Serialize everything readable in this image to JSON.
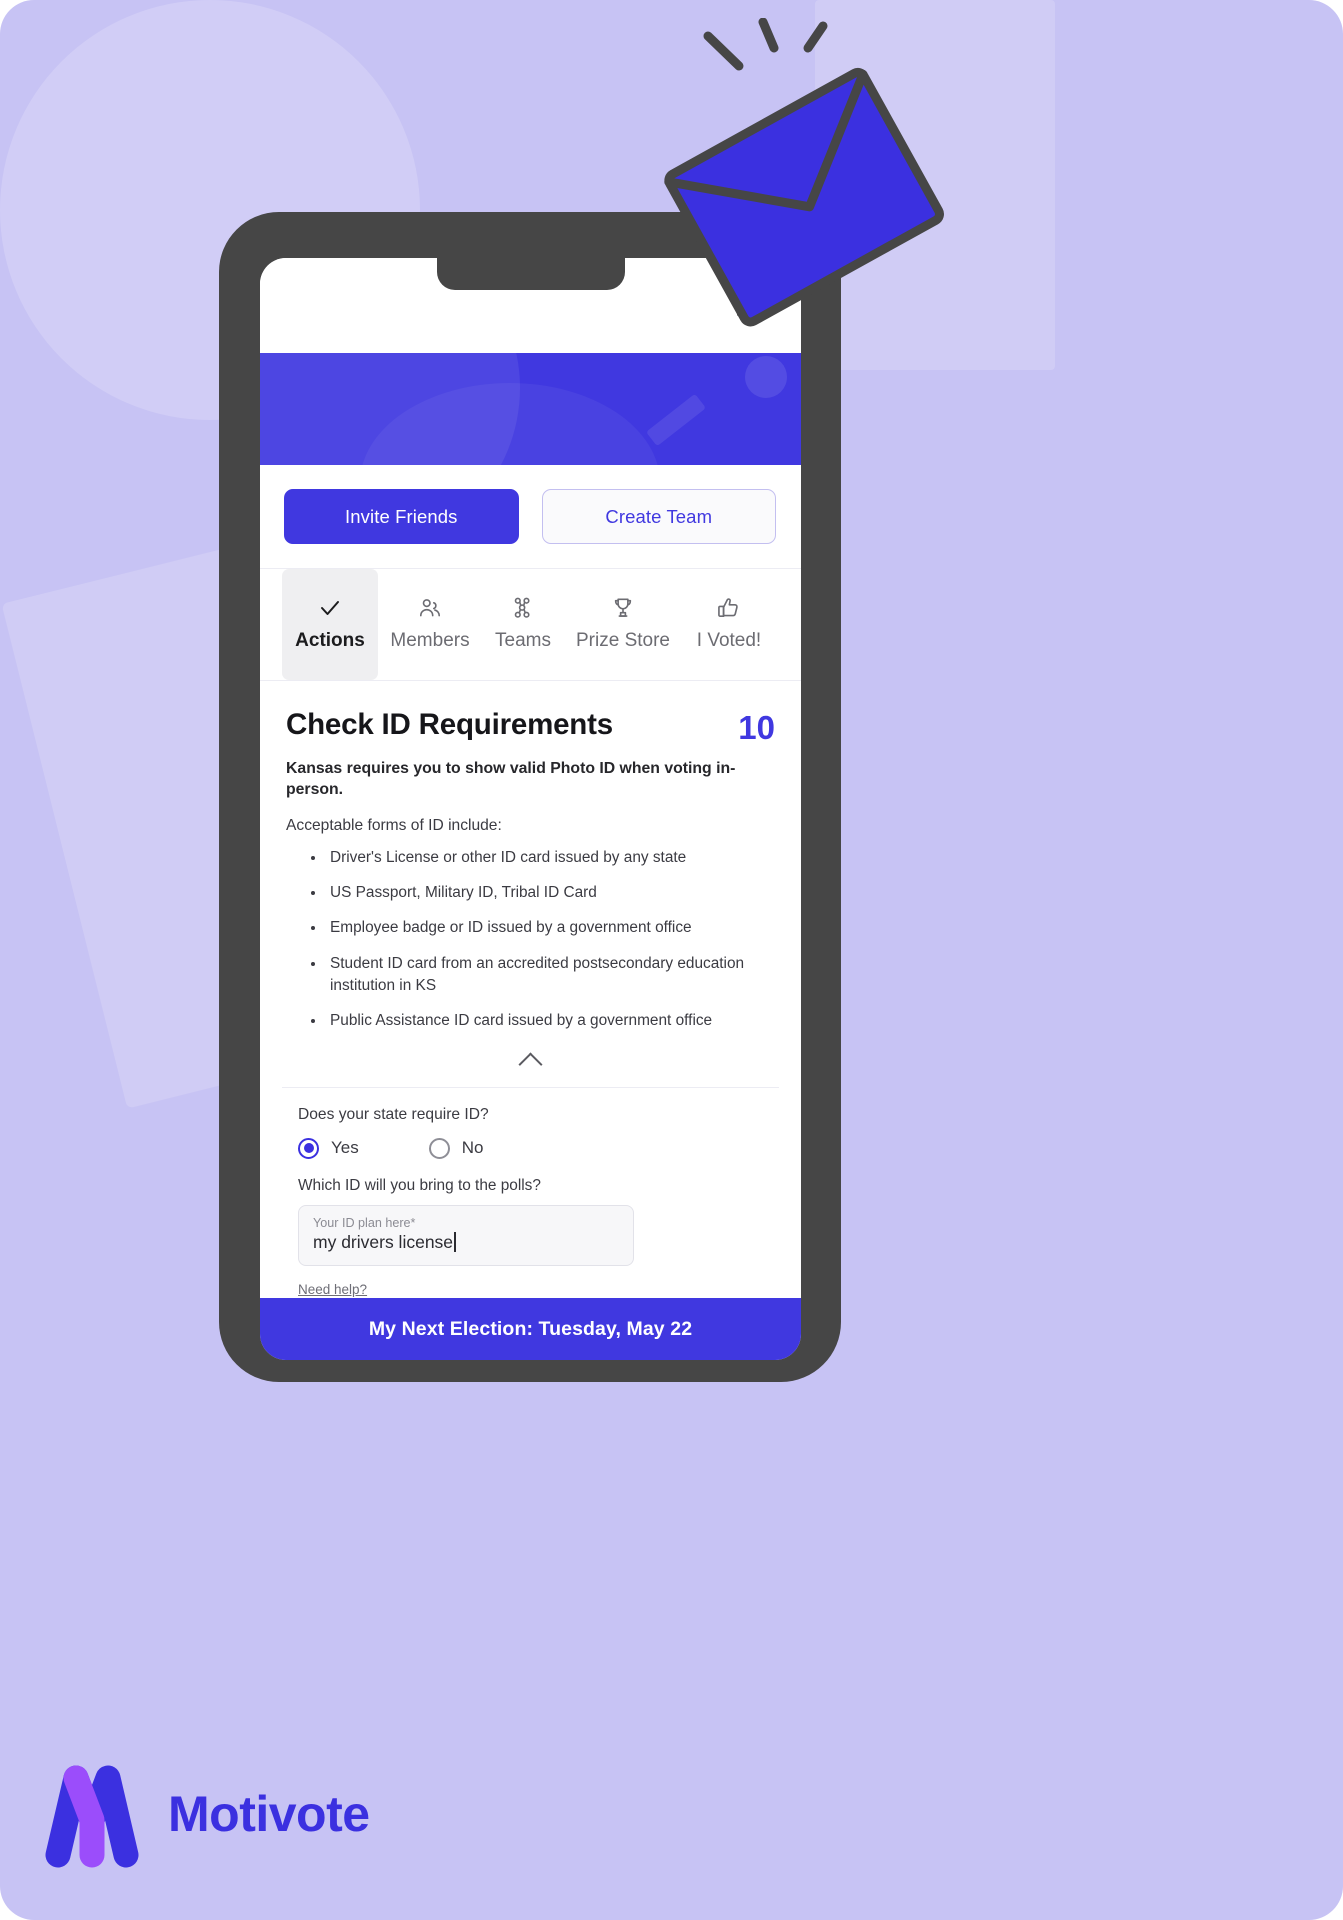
{
  "brand": {
    "name": "Motivote",
    "logo_icon": "motivote-m-logo",
    "accent": "#4038e0",
    "accent_light": "#9b4dfb",
    "page_background": "#c7c3f4"
  },
  "illustration": {
    "envelope_icon": "envelope-icon",
    "envelope_fill": "#3b30e0",
    "stroke": "#464646"
  },
  "app": {
    "menu_icon": "hamburger-menu-icon",
    "cta": {
      "invite_label": "Invite Friends",
      "create_label": "Create Team"
    },
    "tabs": [
      {
        "label": "Actions",
        "icon": "check-icon",
        "active": true
      },
      {
        "label": "Members",
        "icon": "people-icon",
        "active": false
      },
      {
        "label": "Teams",
        "icon": "team-group-icon",
        "active": false
      },
      {
        "label": "Prize Store",
        "icon": "trophy-icon",
        "active": false
      },
      {
        "label": "I Voted!",
        "icon": "thumbs-up-icon",
        "active": false
      }
    ],
    "action_card": {
      "title": "Check ID Requirements",
      "points": "10",
      "lead": "Kansas requires you to show valid Photo ID when voting in-person.",
      "sub": "Acceptable forms of ID include:",
      "id_list": [
        "Driver's License or other ID card issued by any state",
        "US Passport, Military ID, Tribal ID Card",
        "Employee badge or ID issued by a government office",
        "Student ID card from an accredited postsecondary education institution in KS",
        "Public Assistance ID card issued by a government office"
      ],
      "collapse_icon": "chevron-up-icon"
    },
    "form": {
      "require_question": "Does your state require ID?",
      "options": [
        {
          "label": "Yes",
          "selected": true
        },
        {
          "label": "No",
          "selected": false
        }
      ],
      "which_id_question": "Which ID will you bring to the polls?",
      "input_placeholder": "Your ID plan here*",
      "input_value": "my drivers license",
      "help_link": "Need help?"
    },
    "bottom_bar": "My Next Election: Tuesday, May 22"
  }
}
